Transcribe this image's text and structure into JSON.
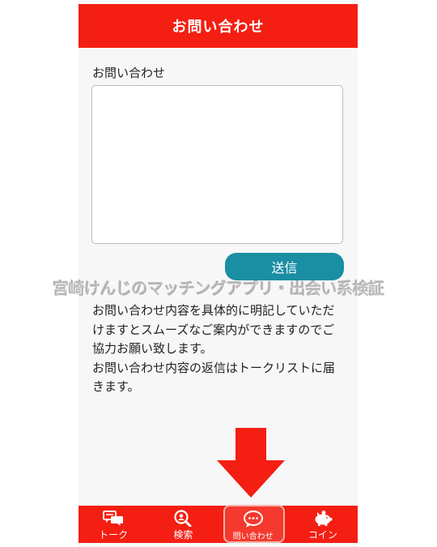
{
  "header": {
    "title": "お問い合わせ"
  },
  "form": {
    "label": "お問い合わせ",
    "textarea_value": "",
    "send_label": "送信"
  },
  "info": {
    "paragraph1": "お問い合わせ内容を具体的に明記していただけますとスムーズなご案内ができますのでご協力お願い致します。",
    "paragraph2": "お問い合わせ内容の返信はトークリストに届きます。"
  },
  "watermark": {
    "text": "宮崎けんじのマッチングアプリ・出会い系検証"
  },
  "tabbar": {
    "items": [
      {
        "label": "トーク",
        "icon": "chat-bubbles-icon"
      },
      {
        "label": "検索",
        "icon": "search-person-icon"
      },
      {
        "label": "問い合わせ",
        "icon": "speech-bubble-icon",
        "active": true
      },
      {
        "label": "コイン",
        "icon": "piggy-bank-icon"
      }
    ]
  },
  "colors": {
    "primary": "#f41e12",
    "button": "#1a8ea3",
    "arrow": "#f41e12"
  }
}
